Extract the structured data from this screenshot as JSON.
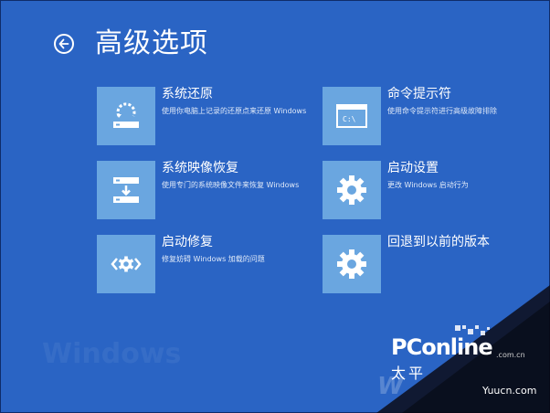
{
  "page": {
    "title": "高级选项",
    "back_icon": "back-arrow-icon"
  },
  "colors": {
    "background": "#2a64c4",
    "tile": "#6aa6e0",
    "text": "#ffffff"
  },
  "options": [
    {
      "title": "系统还原",
      "desc": "使用你电脑上记录的还原点来还原 Windows",
      "icon": "system-restore-icon"
    },
    {
      "title": "命令提示符",
      "desc": "使用命令提示符进行高级故障排除",
      "icon": "command-prompt-icon"
    },
    {
      "title": "系统映像恢复",
      "desc": "使用专门的系统映像文件来恢复 Windows",
      "icon": "system-image-icon"
    },
    {
      "title": "启动设置",
      "desc": "更改 Windows 启动行为",
      "icon": "gear-icon"
    },
    {
      "title": "启动修复",
      "desc": "修复妨碍 Windows 加载的问题",
      "icon": "startup-repair-icon"
    },
    {
      "title": "回退到以前的版本",
      "desc": "",
      "icon": "gear-icon"
    }
  ],
  "command_prompt_glyph": "C:\\",
  "watermark": {
    "brand": "PConline",
    "domain_small": ".com.cn",
    "chinese": "太平",
    "site": "Yuucn.com",
    "faint_left": "Windows",
    "win_letter": "W"
  }
}
